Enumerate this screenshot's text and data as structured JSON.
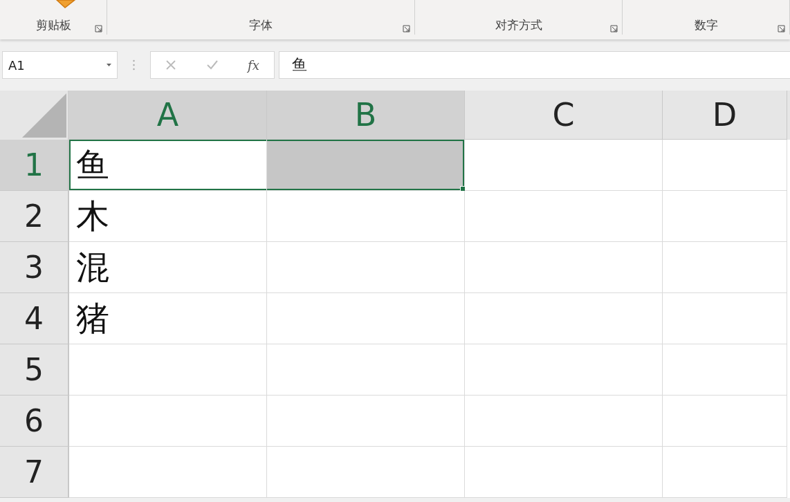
{
  "ribbon": {
    "groups": [
      {
        "label": "剪贴板"
      },
      {
        "label": "字体"
      },
      {
        "label": "对齐方式"
      },
      {
        "label": "数字"
      }
    ]
  },
  "name_box": {
    "value": "A1"
  },
  "formula_bar": {
    "function_label": "fx",
    "value": "鱼"
  },
  "sheet": {
    "columns": [
      {
        "label": "A",
        "selected": true
      },
      {
        "label": "B",
        "selected": true
      },
      {
        "label": "C",
        "selected": false
      },
      {
        "label": "D",
        "selected": false
      }
    ],
    "rows": [
      {
        "label": "1",
        "selected": true,
        "cells": [
          {
            "value": "鱼",
            "selected": true
          },
          {
            "selected": true
          },
          {
            "selected": false
          },
          {
            "selected": false
          }
        ]
      },
      {
        "label": "2",
        "selected": false,
        "cells": [
          {
            "value": "木",
            "selected": false
          },
          {
            "selected": false
          },
          {
            "selected": false
          },
          {
            "selected": false
          }
        ]
      },
      {
        "label": "3",
        "selected": false,
        "cells": [
          {
            "value": "混",
            "selected": false
          },
          {
            "selected": false
          },
          {
            "selected": false
          },
          {
            "selected": false
          }
        ]
      },
      {
        "label": "4",
        "selected": false,
        "cells": [
          {
            "value": "猪",
            "selected": false
          },
          {
            "selected": false
          },
          {
            "selected": false
          },
          {
            "selected": false
          }
        ]
      },
      {
        "label": "5",
        "selected": false,
        "cells": [
          {
            "selected": false
          },
          {
            "selected": false
          },
          {
            "selected": false
          },
          {
            "selected": false
          }
        ]
      },
      {
        "label": "6",
        "selected": false,
        "cells": [
          {
            "selected": false
          },
          {
            "selected": false
          },
          {
            "selected": false
          },
          {
            "selected": false
          }
        ]
      },
      {
        "label": "7",
        "selected": false,
        "cells": [
          {
            "selected": false
          },
          {
            "selected": false
          },
          {
            "selected": false
          },
          {
            "selected": false
          }
        ]
      }
    ]
  }
}
